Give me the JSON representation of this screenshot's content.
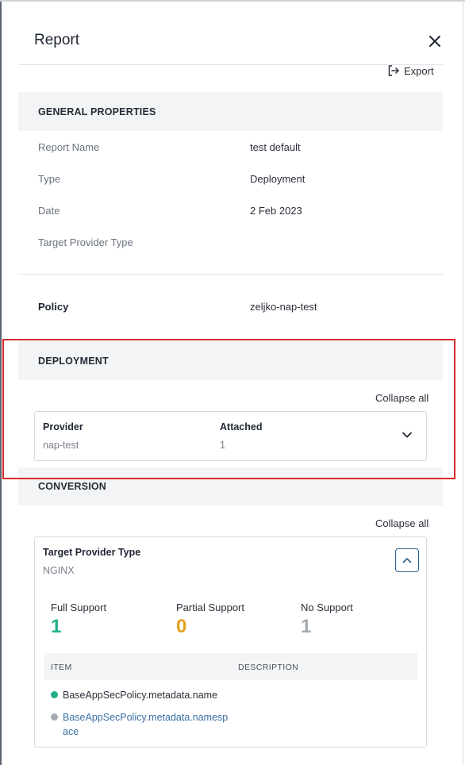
{
  "header": {
    "title": "Report",
    "export_label": "Export"
  },
  "colors": {
    "accent": "#2c5f8e",
    "highlight": "#d92b2b",
    "full_support": "#22b08a",
    "partial_support": "#e0a01c",
    "no_support": "#a6abb3"
  },
  "general": {
    "section_title": "GENERAL PROPERTIES",
    "rows": [
      {
        "label": "Report Name",
        "value": "test default"
      },
      {
        "label": "Type",
        "value": "Deployment"
      },
      {
        "label": "Date",
        "value": "2 Feb 2023"
      },
      {
        "label": "Target Provider Type",
        "value": ""
      }
    ],
    "policy_label": "Policy",
    "policy_value": "zeljko-nap-test"
  },
  "deployment": {
    "section_title": "DEPLOYMENT",
    "collapse_all": "Collapse all",
    "card": {
      "provider_label": "Provider",
      "provider_value": "nap-test",
      "attached_label": "Attached",
      "attached_value": "1"
    }
  },
  "conversion": {
    "section_title": "CONVERSION",
    "collapse_all": "Collapse all",
    "card": {
      "target_label": "Target Provider Type",
      "target_value": "NGINX",
      "stats": [
        {
          "label": "Full Support",
          "value": "1"
        },
        {
          "label": "Partial Support",
          "value": "0"
        },
        {
          "label": "No Support",
          "value": "1"
        }
      ],
      "table": {
        "col_item": "ITEM",
        "col_description": "DESCRIPTION",
        "rows": [
          {
            "item": "BaseAppSecPolicy.metadata.name",
            "status": "full"
          },
          {
            "item": "BaseAppSecPolicy.metadata.namespace",
            "status": "none"
          }
        ]
      }
    }
  },
  "icons": {
    "close": "close-icon",
    "export": "export-icon",
    "chevron_down": "chevron-down-icon",
    "chevron_up": "chevron-up-icon"
  }
}
